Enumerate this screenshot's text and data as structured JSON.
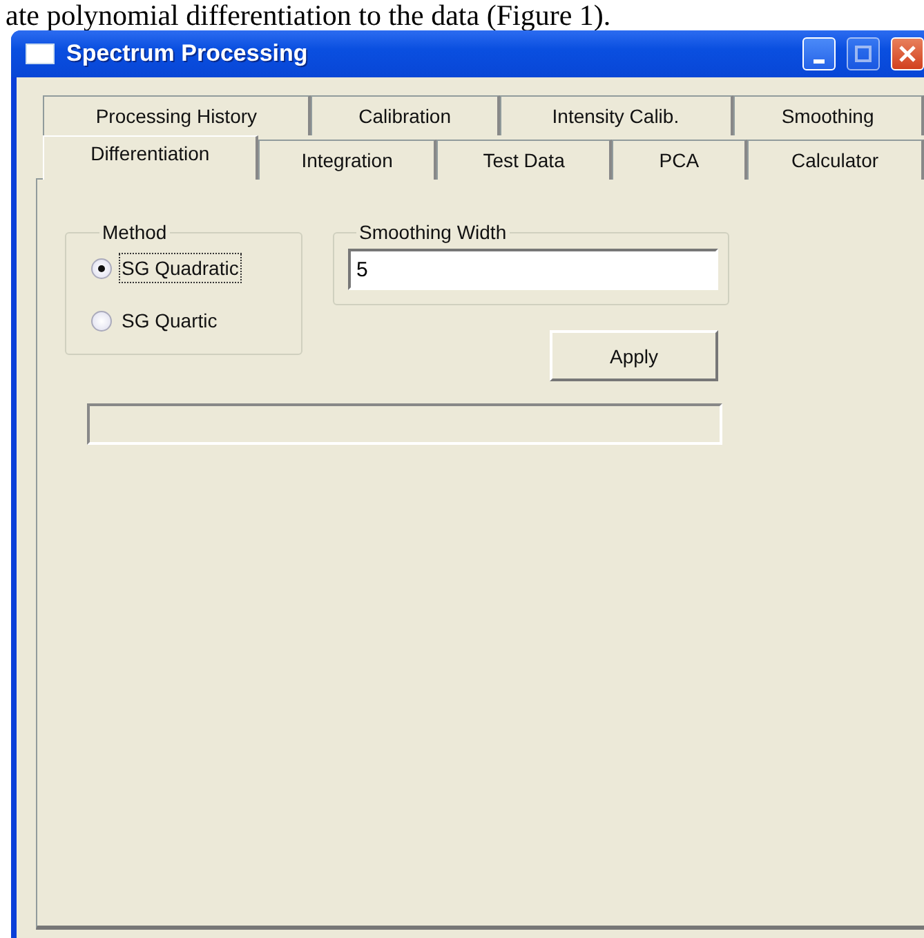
{
  "caption": "ate polynomial differentiation to the data (Figure 1).",
  "window": {
    "title": "Spectrum Processing"
  },
  "tab_rows": [
    [
      {
        "label": "Processing History",
        "selected": false
      },
      {
        "label": "Calibration",
        "selected": false
      },
      {
        "label": "Intensity Calib.",
        "selected": false
      },
      {
        "label": "Smoothing",
        "selected": false
      }
    ],
    [
      {
        "label": "Differentiation",
        "selected": true
      },
      {
        "label": "Integration",
        "selected": false
      },
      {
        "label": "Test Data",
        "selected": false
      },
      {
        "label": "PCA",
        "selected": false
      },
      {
        "label": "Calculator",
        "selected": false
      }
    ]
  ],
  "method": {
    "label": "Method",
    "options": [
      {
        "label": "SG Quadratic",
        "selected": true
      },
      {
        "label": "SG Quartic",
        "selected": false
      }
    ]
  },
  "smoothing_width": {
    "label": "Smoothing Width",
    "value": "5"
  },
  "buttons": [
    "Apply"
  ]
}
